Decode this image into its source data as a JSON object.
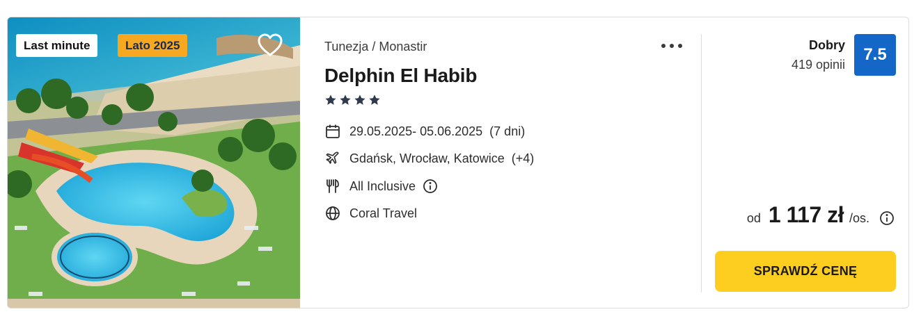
{
  "badges": {
    "last_minute": "Last minute",
    "season": "Lato 2025"
  },
  "offer": {
    "breadcrumb": "Tunezja / Monastir",
    "hotel_name": "Delphin El Habib",
    "stars": 4,
    "dates": "29.05.2025- 05.06.2025",
    "duration": "(7 dni)",
    "departure": "Gdańsk, Wrocław, Katowice",
    "departure_more": "(+4)",
    "board": "All Inclusive",
    "operator": "Coral Travel"
  },
  "rating": {
    "label": "Dobry",
    "reviews": "419 opinii",
    "score": "7.5"
  },
  "price": {
    "from": "od",
    "value": "1 117 zł",
    "unit": "/os."
  },
  "cta": {
    "label": "SPRAWDŹ CENĘ"
  },
  "colors": {
    "score_bg": "#1467c6",
    "cta_bg": "#fdcd1f",
    "season_badge": "#f6a821",
    "stars": "#2f3b4c"
  },
  "icons": [
    "heart-icon",
    "more-icon",
    "star-icon",
    "calendar-icon",
    "plane-icon",
    "cutlery-icon",
    "info-icon",
    "globe-icon"
  ]
}
